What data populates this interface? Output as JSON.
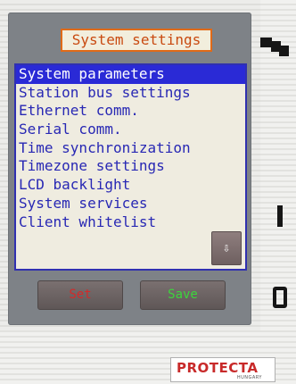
{
  "title": "System settings",
  "menu": {
    "items": [
      {
        "label": "System parameters"
      },
      {
        "label": "Station bus settings"
      },
      {
        "label": "Ethernet comm."
      },
      {
        "label": "Serial comm."
      },
      {
        "label": "Time synchronization"
      },
      {
        "label": "Timezone settings"
      },
      {
        "label": "LCD backlight"
      },
      {
        "label": "System services"
      },
      {
        "label": "Client whitelist"
      }
    ],
    "selected_index": 0,
    "scroll_down_glyph": "⇩"
  },
  "buttons": {
    "set_label": "Set",
    "save_label": "Save"
  },
  "side_buttons": {
    "top_icon": "square-windows-icon",
    "middle_label": "I",
    "bottom_label": "O"
  },
  "logo": {
    "brand": "PROTECTA",
    "sub": "HUNGARY"
  },
  "colors": {
    "title_border": "#e06a18",
    "title_text": "#c94a10",
    "menu_text": "#2828b4",
    "selected_bg": "#2a2ad6",
    "set_text": "#d32a2a",
    "save_text": "#3cd63c"
  }
}
